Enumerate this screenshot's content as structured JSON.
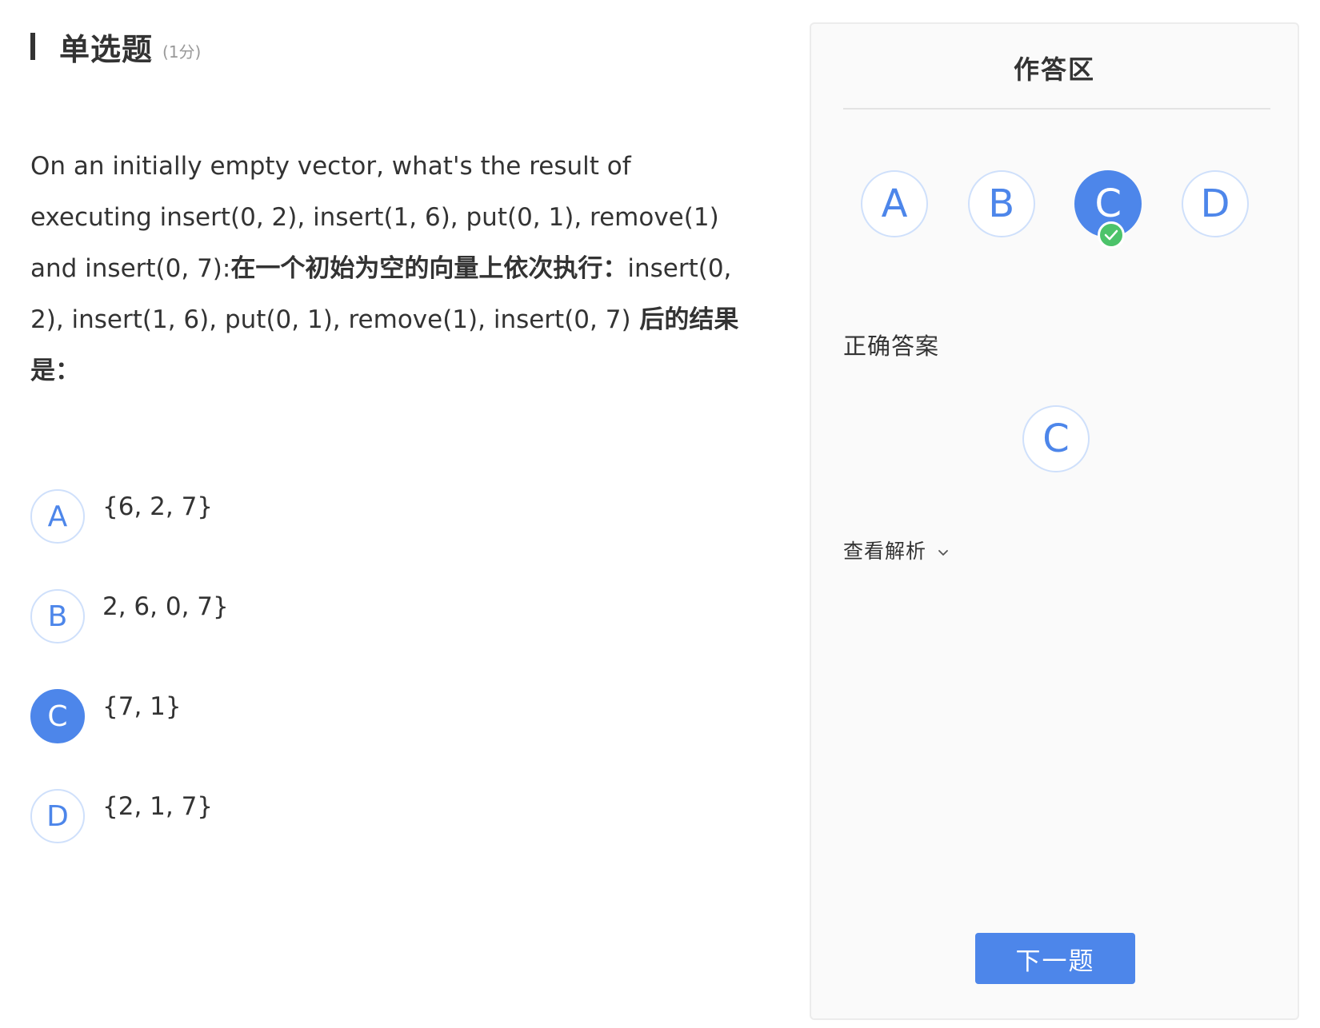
{
  "question": {
    "type_label": "单选题",
    "score": "(1分)",
    "text_en": "On an initially empty vector, what's the result of executing insert(0, 2), insert(1, 6), put(0, 1), remove(1) and insert(0, 7):",
    "text_cn_1": "在一个初始为空的向量上依次执行：",
    "text_code": "insert(0, 2), insert(1, 6), put(0, 1), remove(1), insert(0, 7)",
    "text_cn_2": " 后的结果是："
  },
  "options": [
    {
      "letter": "A",
      "text": "{6, 2, 7}"
    },
    {
      "letter": "B",
      "text": "2, 6, 0, 7}"
    },
    {
      "letter": "C",
      "text": "{7, 1}"
    },
    {
      "letter": "D",
      "text": "{2, 1, 7}"
    }
  ],
  "selected_option": "C",
  "panel": {
    "title": "作答区",
    "choices": [
      "A",
      "B",
      "C",
      "D"
    ],
    "correct_label": "正确答案",
    "correct_answer": "C",
    "analysis_label": "查看解析",
    "next_button": "下一题"
  },
  "colors": {
    "accent": "#4d86ea",
    "success": "#4cc36a",
    "border_light": "#cfe0fb",
    "text": "#333333",
    "muted": "#999999",
    "panel_bg": "#fafafa"
  }
}
